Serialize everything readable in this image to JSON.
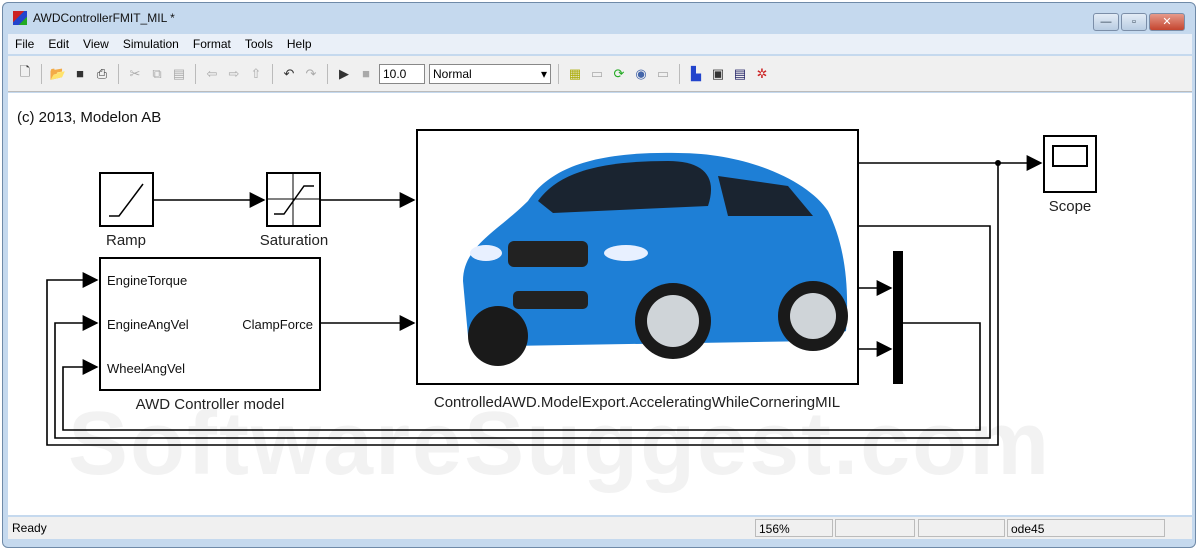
{
  "window": {
    "title": "AWDControllerFMIT_MIL *"
  },
  "menu": [
    "File",
    "Edit",
    "View",
    "Simulation",
    "Format",
    "Tools",
    "Help"
  ],
  "toolbar": {
    "stop_time": "10.0",
    "sim_mode": "Normal"
  },
  "diagram": {
    "copyright": "(c) 2013, Modelon AB",
    "ramp": "Ramp",
    "saturation": "Saturation",
    "controller": {
      "label": "AWD Controller model",
      "inputs": [
        "EngineTorque",
        "EngineAngVel",
        "WheelAngVel"
      ],
      "output": "ClampForce"
    },
    "fmu": "ControlledAWD.ModelExport.AcceleratingWhileCorneringMIL",
    "scope": "Scope"
  },
  "status": {
    "text": "Ready",
    "zoom": "156%",
    "solver": "ode45"
  }
}
